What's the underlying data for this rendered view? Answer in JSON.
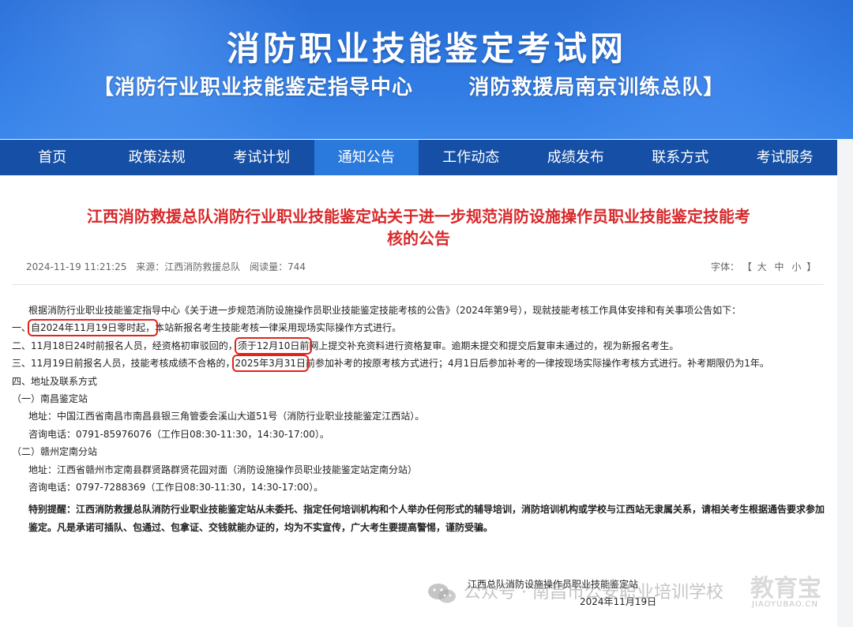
{
  "header": {
    "site_title": "消防职业技能鉴定考试网",
    "subtitle": "【消防行业职业技能鉴定指导中心       消防救援局南京训练总队】"
  },
  "nav": {
    "items": [
      {
        "label": "首页"
      },
      {
        "label": "政策法规"
      },
      {
        "label": "考试计划"
      },
      {
        "label": "通知公告"
      },
      {
        "label": "工作动态"
      },
      {
        "label": "成绩发布"
      },
      {
        "label": "联系方式"
      },
      {
        "label": "考试服务"
      }
    ],
    "active_index": 3
  },
  "article": {
    "title_line1": "江西消防救援总队消防行业职业技能鉴定站关于进一步规范消防设施操作员职业技能鉴定技能考",
    "title_line2": "核的公告",
    "meta": {
      "datetime": "2024-11-19 11:21:25",
      "source": "来源：江西消防救援总队",
      "reads": "阅读量：744"
    },
    "font_size": {
      "label": "字体：",
      "open": "【",
      "large": "大",
      "medium": "中",
      "small": "小",
      "close": "】"
    },
    "body": {
      "intro": "根据消防行业职业技能鉴定指导中心《关于进一步规范消防设施操作员职业技能鉴定技能考核的公告》（2024年第9号），现就技能考核工作具体安排和有关事项公告如下：",
      "item1_prefix": "一、",
      "item1_hl": "自2024年11月19日零时起，",
      "item1_rest": "本站新报名考生技能考核一律采用现场实际操作方式进行。",
      "item2_prefix": "二、11月18日24时前报名人员，经资格初审驳回的，",
      "item2_hl": "须于12月10日前",
      "item2_rest": "网上提交补充资料进行资格复审。逾期未提交和提交后复审未通过的，视为新报名考生。",
      "item3_prefix": "三、11月19日前报名人员，技能考核成绩不合格的，",
      "item3_hl": "2025年3月31日",
      "item3_rest": "前参加补考的按原考核方式进行；4月1日后参加补考的一律按现场实际操作考核方式进行。补考期限仍为1年。",
      "item4": "四、地址及联系方式",
      "sub1": "（一）南昌鉴定站",
      "sub1_addr": "地址：中国江西省南昌市南昌县银三角管委会溪山大道51号（消防行业职业技能鉴定江西站）。",
      "sub1_phone": "咨询电话：0791-85976076（工作日08:30-11:30，14:30-17:00）。",
      "sub2": "（二）赣州定南分站",
      "sub2_addr": "地址：江西省赣州市定南县群贤路群贤花园对面（消防设施操作员职业技能鉴定站定南分站）",
      "sub2_phone": "咨询电话：0797-7288369（工作日08:30-11:30，14:30-17:00）。",
      "warning": "特别提醒：江西消防救援总队消防行业职业技能鉴定站从未委托、指定任何培训机构和个人举办任何形式的辅导培训，消防培训机构或学校与江西站无隶属关系，请相关考生根据通告要求参加鉴定。凡是承诺可插队、包通过、包拿证、交钱就能办证的，均为不实宣传，广大考生要提高警惕，谨防受骗。"
    },
    "signature": {
      "org": "江西总队消防设施操作员职业技能鉴定站",
      "date": "2024年11月19日"
    }
  },
  "watermark": {
    "text": "公众号 · 南昌市公安职业培训学校",
    "logo": "教育宝",
    "logo_sub": "JIAOYUBAO.CN"
  },
  "colors": {
    "nav_bg": "#1550a6",
    "nav_active": "#2a79dd",
    "title_red": "#d8282a",
    "highlight_box": "#e2231a"
  }
}
